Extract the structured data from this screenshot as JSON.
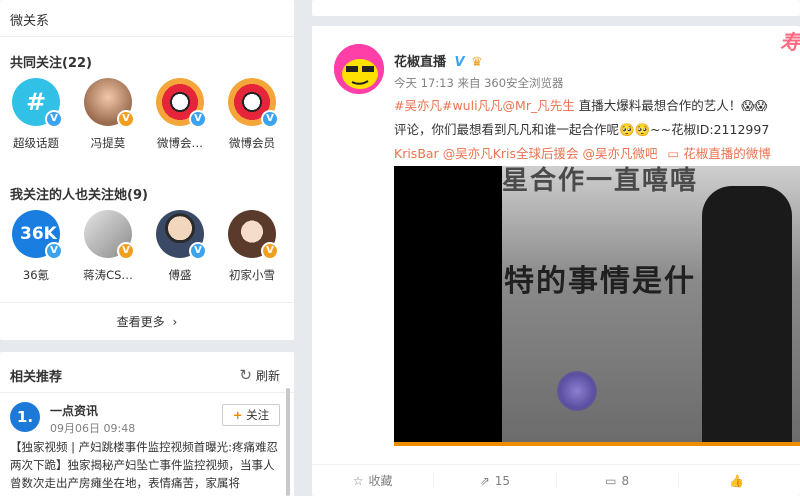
{
  "sidebar": {
    "relations_title": "微关系",
    "common_follow_title": "共同关注(22)",
    "common_follow": [
      {
        "name": "超级话题",
        "avatar": "hash-icon",
        "bg": "#32c1e6",
        "badge": "blue"
      },
      {
        "name": "冯提莫",
        "avatar": "photo-avatar",
        "bg": "#d8a98a",
        "badge": "gold"
      },
      {
        "name": "微博会…",
        "avatar": "weibo-eye-icon",
        "bg": "#f5a63a",
        "badge": "blue"
      },
      {
        "name": "微博会员",
        "avatar": "weibo-eye-icon",
        "bg": "#f5a63a",
        "badge": "blue"
      }
    ],
    "also_follow_title": "我关注的人也关注她(9)",
    "also_follow": [
      {
        "name": "36氪",
        "avatar": "36kr-logo",
        "bg": "#1a7ee0",
        "badge": "blue"
      },
      {
        "name": "蒋涛CS…",
        "avatar": "photo-avatar",
        "bg": "#c9c9c9",
        "badge": "gold"
      },
      {
        "name": "傅盛",
        "avatar": "photo-avatar",
        "bg": "#e9e3dc",
        "badge": "blue"
      },
      {
        "name": "初家小雪",
        "avatar": "photo-avatar",
        "bg": "#d4b5a0",
        "badge": "gold"
      }
    ],
    "see_more": "查看更多",
    "recommend_title": "相关推荐",
    "refresh": "刷新",
    "rec_item": {
      "logo": "1.",
      "name": "一点资讯",
      "time": "09月06日 09:48",
      "follow": "关注",
      "text": "【独家视频 | 产妇跳楼事件监控视频首曝光:疼痛难忍两次下跪】独家揭秘产妇坠亡事件监控视频，当事人曾数次走出产房瘫坐在地，表情痛苦，家属将"
    }
  },
  "post": {
    "author": "花椒直播",
    "meta": "今天 17:13 来自 360安全浏览器",
    "line1_tag": "#吴亦凡#wuli凡凡",
    "line1_mention": "@Mr_凡先生",
    "line1_text": " 直播大爆料最想合作的艺人！😱😱",
    "line2_text": "评论，你们最想看到凡凡和谁一起合作呢🥺🥺~~花椒ID:2112997",
    "line3_a": "KrisBar",
    "line3_b": "@吴亦凡Kris全球后援会",
    "line3_c": "@吴亦凡微吧",
    "line3_d": "花椒直播的微博",
    "video_caption_1": "星合作一直嘻嘻",
    "video_caption_2": "特的事情是什",
    "brand_mark": "寿",
    "actions": {
      "favorite": "收藏",
      "repost": "15",
      "comment": "8",
      "like": ""
    }
  },
  "colors": {
    "link": "#eb7350",
    "accent": "#ff8200"
  }
}
